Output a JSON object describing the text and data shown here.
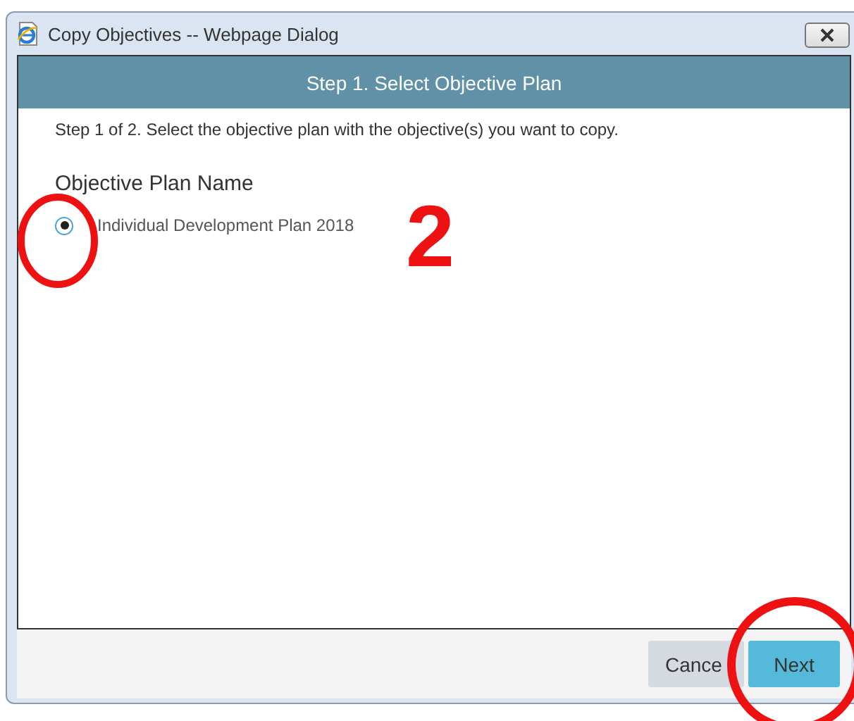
{
  "window": {
    "title": "Copy Objectives -- Webpage Dialog"
  },
  "header": {
    "title": "Step 1. Select Objective Plan"
  },
  "instructions": "Step 1 of 2. Select the objective plan with the objective(s) you want to copy.",
  "section_title": "Objective Plan Name",
  "plans": [
    {
      "label": "Individual Development Plan 2018",
      "selected": true
    }
  ],
  "buttons": [
    {
      "label": "Cance",
      "kind": "secondary"
    },
    {
      "label": "Next",
      "kind": "primary"
    }
  ],
  "annotations": [
    {
      "kind": "circle"
    },
    {
      "kind": "number",
      "text": "2"
    },
    {
      "kind": "circle"
    }
  ]
}
